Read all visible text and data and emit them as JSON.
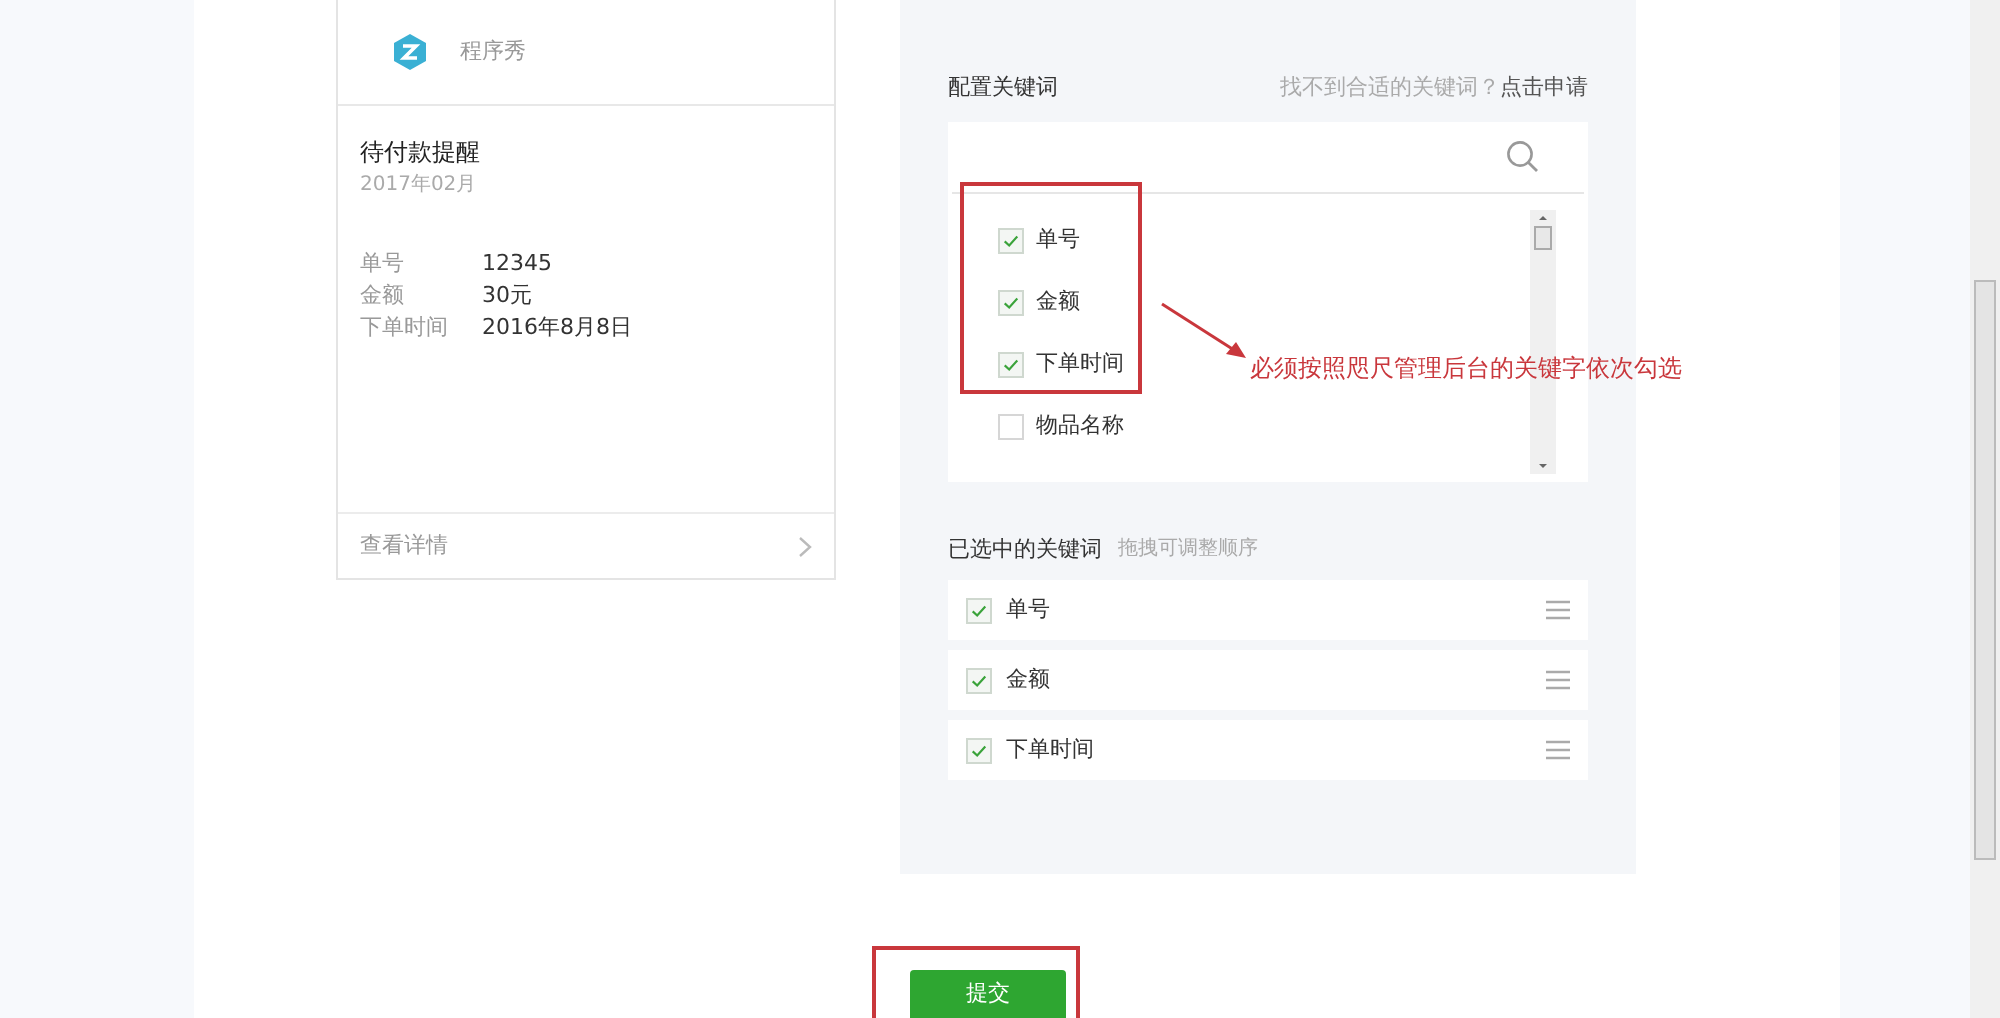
{
  "message_card": {
    "app_name": "程序秀",
    "title": "待付款提醒",
    "date": "2017年02月",
    "fields": [
      {
        "label": "单号",
        "value": "12345"
      },
      {
        "label": "金额",
        "value": "30元"
      },
      {
        "label": "下单时间",
        "value": "2016年8月8日"
      }
    ],
    "footer_link": "查看详情"
  },
  "keyword_config": {
    "title": "配置关键词",
    "hint": "找不到合适的关键词？",
    "apply_link": "点击申请",
    "options": [
      {
        "label": "单号",
        "checked": true
      },
      {
        "label": "金额",
        "checked": true
      },
      {
        "label": "下单时间",
        "checked": true
      },
      {
        "label": "物品名称",
        "checked": false
      }
    ],
    "selected_title": "已选中的关键词",
    "selected_hint": "拖拽可调整顺序",
    "selected": [
      {
        "label": "单号",
        "checked": true
      },
      {
        "label": "金额",
        "checked": true
      },
      {
        "label": "下单时间",
        "checked": true
      }
    ]
  },
  "annotation": "必须按照咫尺管理后台的关键字依次勾选",
  "submit_button": "提交"
}
